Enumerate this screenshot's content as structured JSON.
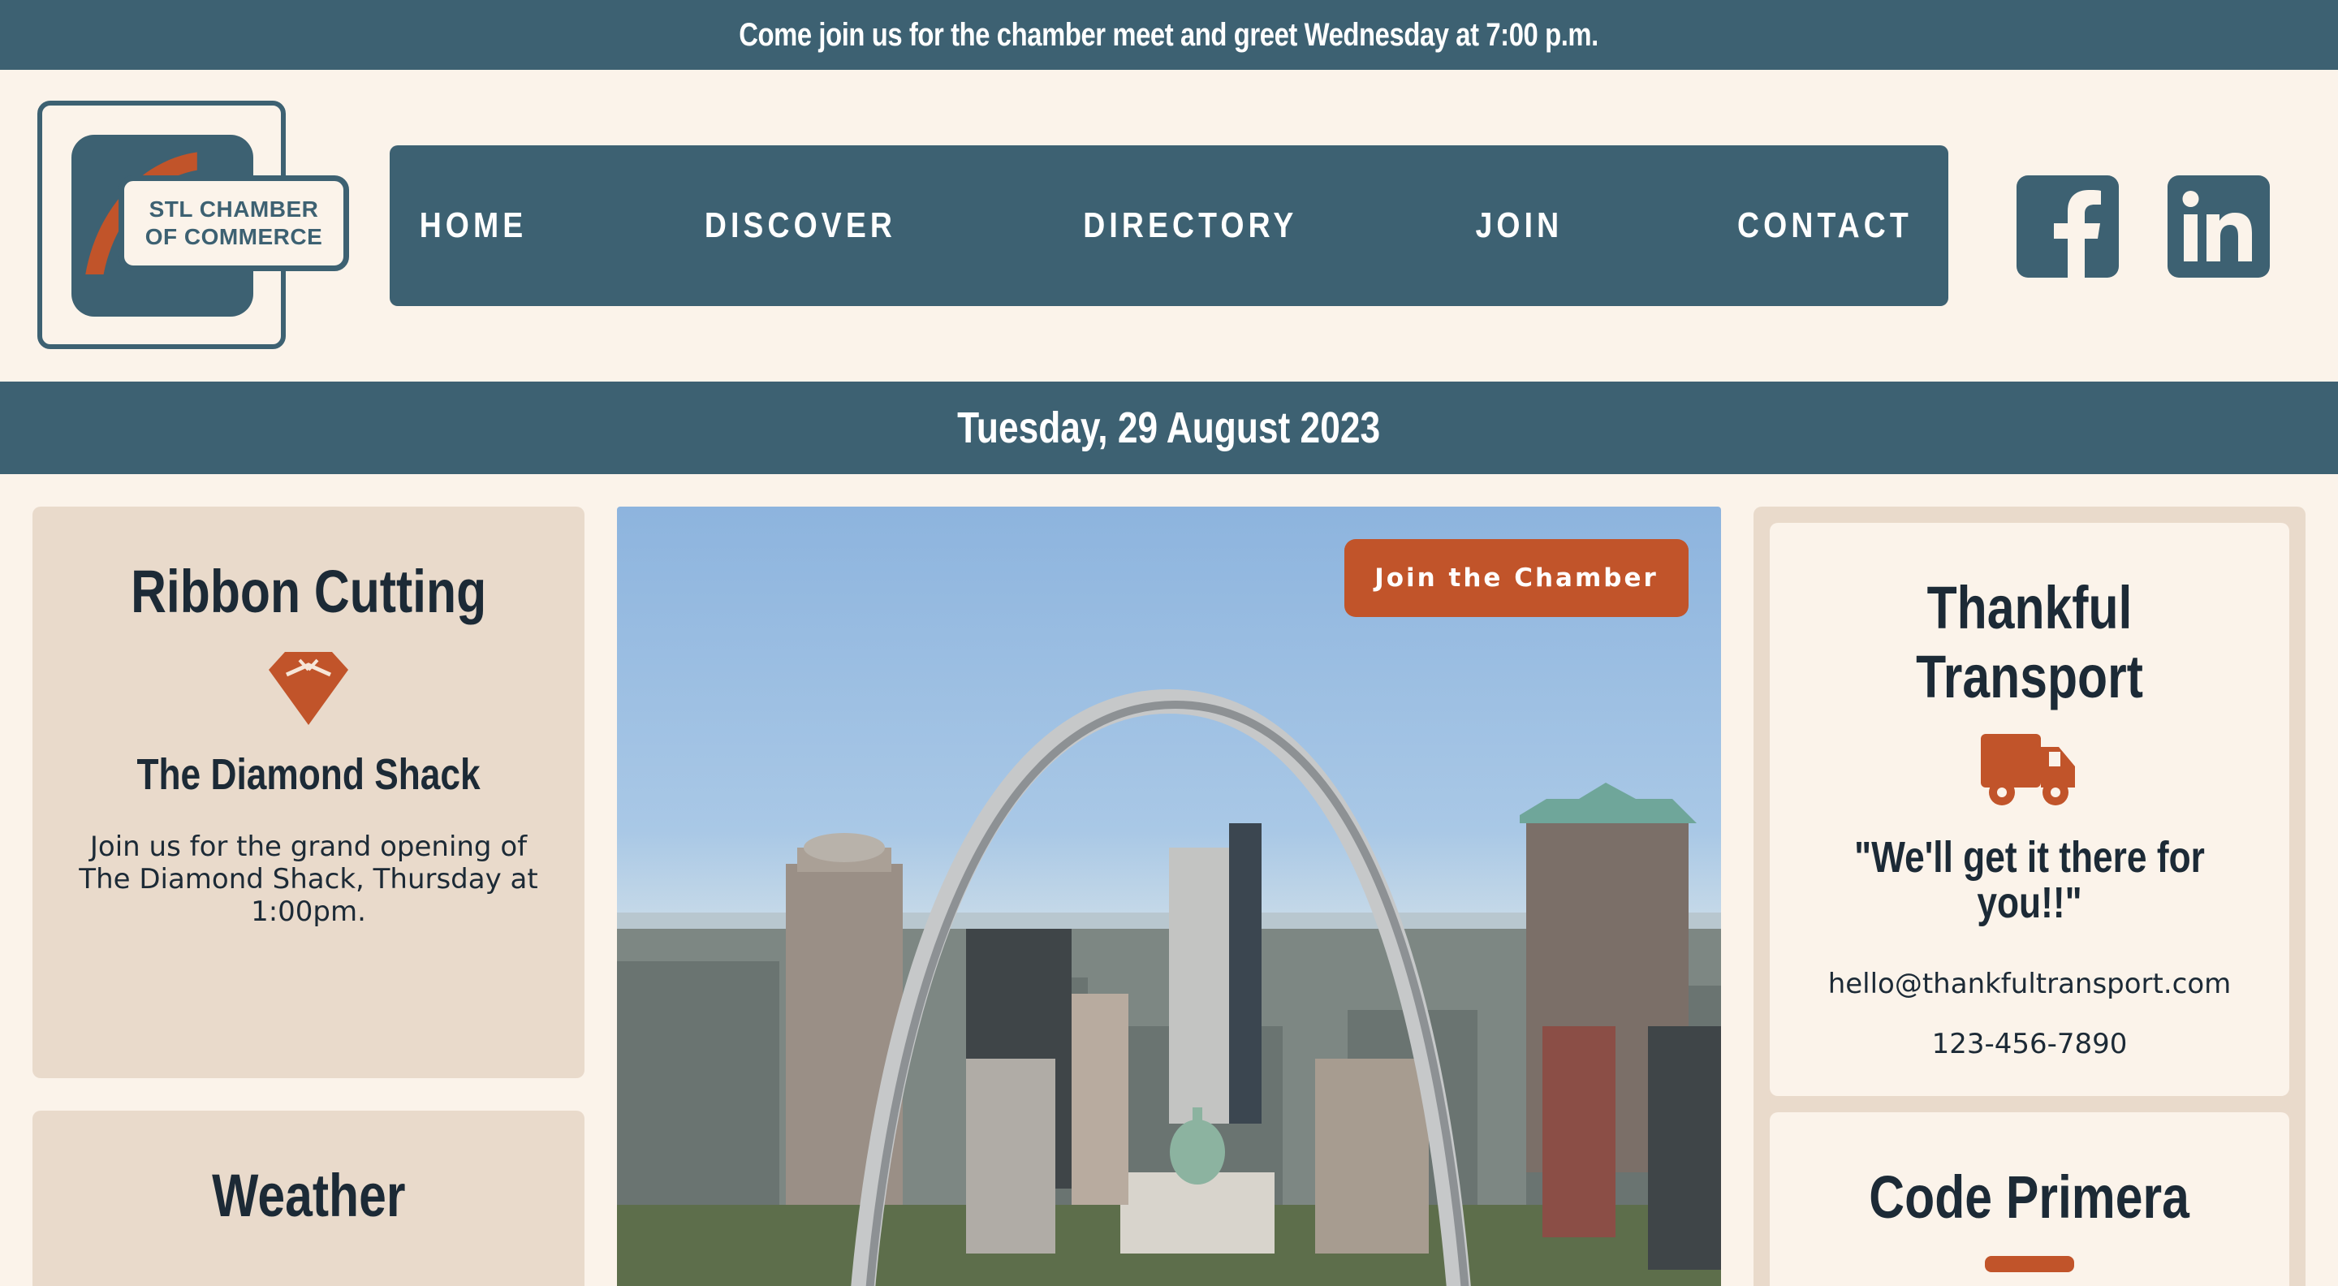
{
  "banner": {
    "text": "Come join us for the chamber meet and greet Wednesday at 7:00 p.m."
  },
  "logo": {
    "line1": "STL CHAMBER",
    "line2": "OF COMMERCE"
  },
  "nav": {
    "items": [
      "HOME",
      "DISCOVER",
      "DIRECTORY",
      "JOIN",
      "CONTACT"
    ]
  },
  "social": {
    "facebook_icon": "facebook-icon",
    "linkedin_icon": "linkedin-icon"
  },
  "date": "Tuesday, 29 August 2023",
  "ribbon": {
    "title": "Ribbon Cutting",
    "icon": "diamond-icon",
    "subtitle": "The Diamond Shack",
    "text": "Join us for the grand opening of The Diamond Shack, Thursday at 1:00pm."
  },
  "weather": {
    "title": "Weather"
  },
  "hero": {
    "button_label": "Join the Chamber"
  },
  "spotlight1": {
    "title": "Thankful Transport",
    "icon": "truck-icon",
    "quote": "\"We'll get it there for you!!\"",
    "email": "hello@thankfultransport.com",
    "phone": "123-456-7890"
  },
  "spotlight2": {
    "title": "Code Primera"
  },
  "colors": {
    "primary": "#3d6172",
    "accent": "#c1542a",
    "background": "#fbf3ea",
    "card": "#e9dacb"
  }
}
